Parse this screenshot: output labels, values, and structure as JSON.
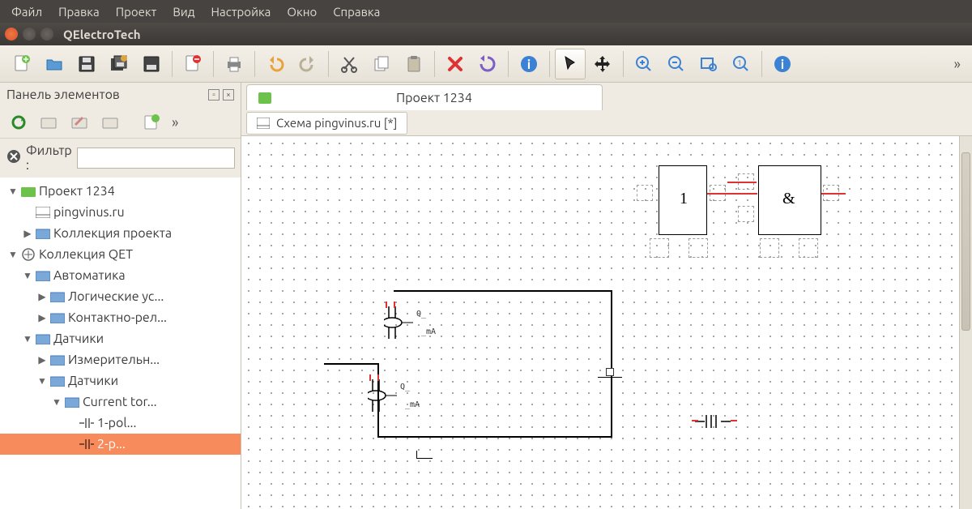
{
  "menu": [
    "Файл",
    "Правка",
    "Проект",
    "Вид",
    "Настройка",
    "Окно",
    "Справка"
  ],
  "window": {
    "title": "QElectroTech"
  },
  "toolbar": {
    "icons": [
      "new-doc",
      "open",
      "save",
      "save-all",
      "save-as",
      "|",
      "close",
      "|",
      "print",
      "|",
      "undo",
      "redo",
      "|",
      "cut",
      "copy",
      "paste",
      "|",
      "delete",
      "rotate",
      "|",
      "info",
      "|",
      "pointer",
      "move",
      "|",
      "zoom-in",
      "zoom-out",
      "zoom-fit",
      "zoom-reset",
      "|",
      "about"
    ]
  },
  "sidebar": {
    "title": "Панель элементов",
    "filter_label": "Фильтр :",
    "filter_value": "",
    "tree": [
      {
        "d": 0,
        "exp": "▼",
        "icon": "folder-green",
        "label": "Проект 1234"
      },
      {
        "d": 1,
        "exp": "",
        "icon": "schema",
        "label": "pingvinus.ru"
      },
      {
        "d": 1,
        "exp": "▶",
        "icon": "folder-blue",
        "label": "Коллекция проекта"
      },
      {
        "d": 0,
        "exp": "▼",
        "icon": "qet",
        "label": "Коллекция QET"
      },
      {
        "d": 1,
        "exp": "▼",
        "icon": "folder-blue",
        "label": "Автоматика"
      },
      {
        "d": 2,
        "exp": "▶",
        "icon": "folder-blue",
        "label": "Логические ус..."
      },
      {
        "d": 2,
        "exp": "▶",
        "icon": "folder-blue",
        "label": "Контактно-рел..."
      },
      {
        "d": 1,
        "exp": "▼",
        "icon": "folder-blue",
        "label": "Датчики"
      },
      {
        "d": 2,
        "exp": "▶",
        "icon": "folder-blue",
        "label": "Измерительн..."
      },
      {
        "d": 2,
        "exp": "▼",
        "icon": "folder-blue",
        "label": "Датчики"
      },
      {
        "d": 3,
        "exp": "▼",
        "icon": "folder-blue",
        "label": "Current tor..."
      },
      {
        "d": 4,
        "exp": "",
        "icon": "elem",
        "label": "1-pol..."
      },
      {
        "d": 4,
        "exp": "",
        "icon": "elem",
        "label": "2-p...",
        "sel": true
      }
    ]
  },
  "doc": {
    "tab_title": "Проект 1234",
    "subtab": "Схема pingvinus.ru [*]"
  },
  "logic": {
    "left": "1",
    "right": "&"
  },
  "q_labels": {
    "q1": "Q_",
    "ma1": "_mA",
    "q2": "Q_",
    "ma2": "_mA"
  }
}
